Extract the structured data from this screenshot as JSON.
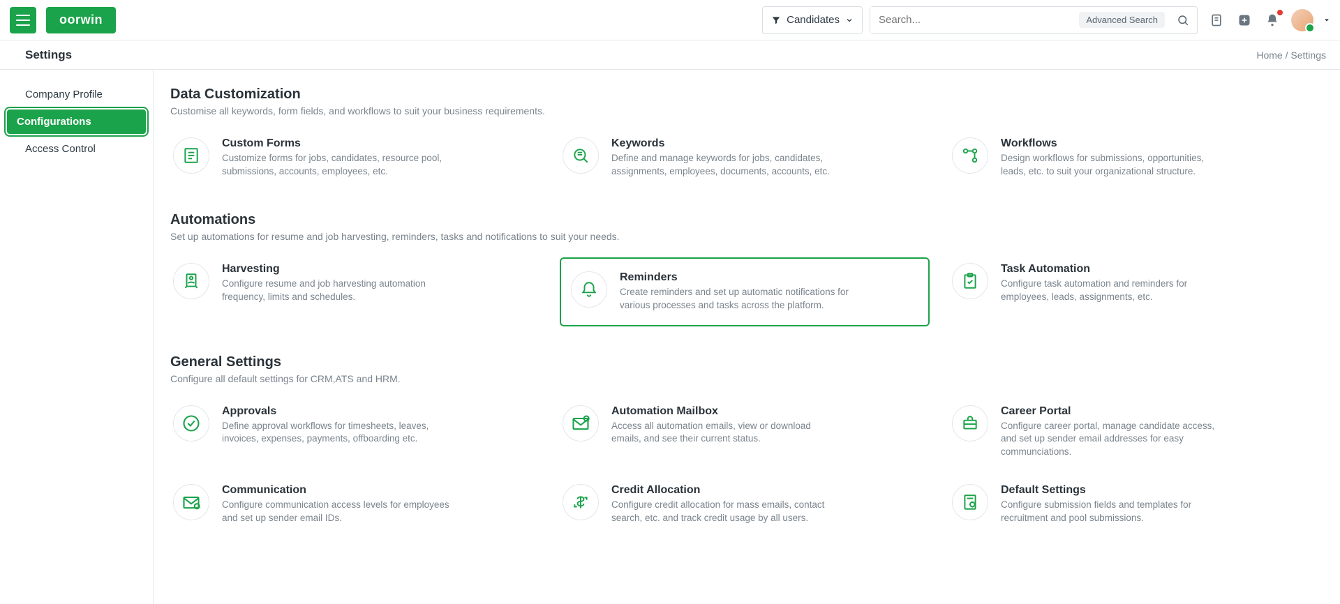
{
  "brand": "oorwin",
  "filter": {
    "label": "Candidates"
  },
  "search": {
    "placeholder": "Search...",
    "advanced_label": "Advanced Search"
  },
  "subbar": {
    "title": "Settings"
  },
  "breadcrumb": {
    "home": "Home",
    "sep": " / ",
    "current": "Settings"
  },
  "sidebar": {
    "items": [
      {
        "label": "Company Profile"
      },
      {
        "label": "Configurations"
      },
      {
        "label": "Access Control"
      }
    ]
  },
  "sections": [
    {
      "title": "Data Customization",
      "desc": "Customise all keywords, form fields, and workflows to suit your business requirements.",
      "cards": [
        {
          "title": "Custom Forms",
          "desc": "Customize forms for jobs, candidates, resource pool, submissions, accounts, employees, etc."
        },
        {
          "title": "Keywords",
          "desc": "Define and manage keywords for jobs, candidates, assignments, employees, documents, accounts, etc."
        },
        {
          "title": "Workflows",
          "desc": "Design workflows for submissions, opportunities, leads, etc. to suit your organizational structure."
        }
      ]
    },
    {
      "title": "Automations",
      "desc": "Set up automations for resume and job harvesting, reminders, tasks and notifications to suit your needs.",
      "cards": [
        {
          "title": "Harvesting",
          "desc": "Configure resume and job harvesting automation frequency, limits and schedules."
        },
        {
          "title": "Reminders",
          "desc": "Create reminders and set up automatic notifications for various processes and tasks across the platform."
        },
        {
          "title": "Task Automation",
          "desc": "Configure task automation and reminders for employees, leads, assignments, etc."
        }
      ]
    },
    {
      "title": "General Settings",
      "desc": "Configure all default settings for CRM,ATS and HRM.",
      "cards": [
        {
          "title": "Approvals",
          "desc": "Define approval workflows for timesheets, leaves, invoices, expenses, payments, offboarding etc."
        },
        {
          "title": "Automation Mailbox",
          "desc": "Access all automation emails, view or download emails, and see their current status."
        },
        {
          "title": "Career Portal",
          "desc": "Configure career portal, manage candidate access, and set up sender email addresses for easy communciations."
        },
        {
          "title": "Communication",
          "desc": "Configure communication access levels for employees and set up sender email IDs."
        },
        {
          "title": "Credit Allocation",
          "desc": "Configure credit allocation for mass emails, contact search, etc. and track credit usage by all users."
        },
        {
          "title": "Default Settings",
          "desc": "Configure submission fields and templates for recruitment and pool submissions."
        }
      ]
    }
  ]
}
